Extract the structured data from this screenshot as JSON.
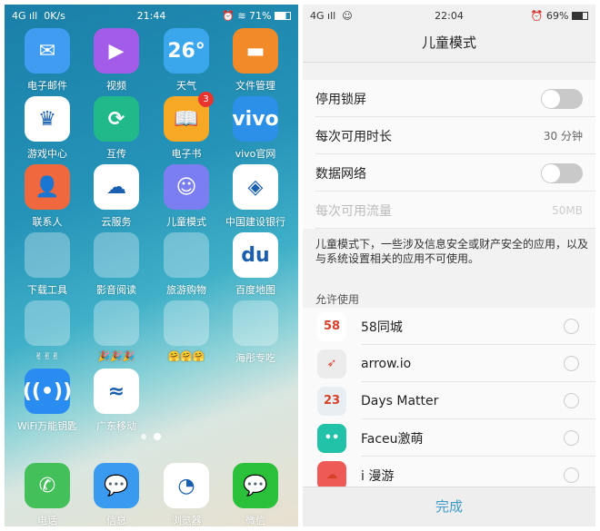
{
  "left_phone": {
    "status": {
      "network": "4G",
      "speed": "0K/s",
      "time": "21:44",
      "battery": "71%"
    },
    "apps": [
      {
        "label": "电子邮件",
        "icon": "mail-icon",
        "color": "#3f9cf0"
      },
      {
        "label": "视频",
        "icon": "play-icon",
        "color": "#a25ce8"
      },
      {
        "label": "天气",
        "icon": "weather-icon",
        "color": "#3aa6ec",
        "text": "26°"
      },
      {
        "label": "文件管理",
        "icon": "folder-icon",
        "color": "#f28a2a"
      },
      {
        "label": "游戏中心",
        "icon": "crown-icon",
        "color": "#ffffff"
      },
      {
        "label": "互传",
        "icon": "sync-icon",
        "color": "#21b98a"
      },
      {
        "label": "电子书",
        "icon": "book-icon",
        "color": "#f7a824",
        "badge": "3"
      },
      {
        "label": "vivo官网",
        "icon": "vivo-icon",
        "color": "#2c8fe8",
        "text": "vivo"
      },
      {
        "label": "联系人",
        "icon": "contact-icon",
        "color": "#f0683d"
      },
      {
        "label": "云服务",
        "icon": "cloud-icon",
        "color": "#ffffff"
      },
      {
        "label": "儿童模式",
        "icon": "baby-face-icon",
        "color": "#7b7ef0"
      },
      {
        "label": "中国建设银行",
        "icon": "ccb-icon",
        "color": "#ffffff"
      },
      {
        "label": "下载工具",
        "icon": "folder-group-icon",
        "folder": 5
      },
      {
        "label": "影音阅读",
        "icon": "folder-group-icon",
        "folder": 6
      },
      {
        "label": "旅游购物",
        "icon": "folder-group-icon",
        "folder": 9
      },
      {
        "label": "百度地图",
        "icon": "map-pin-icon",
        "color": "#ffffff",
        "text": "du"
      },
      {
        "label": "✌✌✌",
        "icon": "folder-group-icon",
        "folder": 7
      },
      {
        "label": "🎉🎉🎉",
        "icon": "folder-group-icon",
        "folder": 6
      },
      {
        "label": "🤗🤗🤗",
        "icon": "folder-group-icon",
        "folder": 9
      },
      {
        "label": "海彤专吃",
        "icon": "folder-group-icon",
        "folder": 2
      },
      {
        "label": "WiFi万能钥匙",
        "icon": "wifi-key-icon",
        "color": "#2a8cf0"
      },
      {
        "label": "广东移动",
        "icon": "china-mobile-icon",
        "color": "#ffffff"
      }
    ],
    "dock": [
      {
        "label": "电话",
        "icon": "phone-icon",
        "color": "#44c05a"
      },
      {
        "label": "信息",
        "icon": "message-icon",
        "color": "#3a9af0"
      },
      {
        "label": "浏览器",
        "icon": "compass-icon",
        "color": "#ffffff"
      },
      {
        "label": "微信",
        "icon": "wechat-icon",
        "color": "#2bc03a"
      }
    ]
  },
  "right_phone": {
    "status": {
      "network": "4G",
      "time": "22:04",
      "battery": "69%"
    },
    "title": "儿童模式",
    "settings": [
      {
        "label": "停用锁屏",
        "toggle": false
      },
      {
        "label": "每次可用时长",
        "value": "30 分钟"
      },
      {
        "label": "数据网络",
        "toggle": false
      },
      {
        "label": "每次可用流量",
        "value": "50MB",
        "disabled": true
      }
    ],
    "note": "儿童模式下，一些涉及信息安全或财产安全的应用，以及与系统设置相关的应用不可使用。",
    "section": "允许使用",
    "allowed_apps": [
      {
        "name": "58同城",
        "icon_text": "58",
        "color": "#ffffff",
        "selected": false
      },
      {
        "name": "arrow.io",
        "icon_text": "➶",
        "color": "#ececec",
        "selected": false
      },
      {
        "name": "Days Matter",
        "icon_text": "23",
        "color": "#e8eef2",
        "selected": false
      },
      {
        "name": "Faceu激萌",
        "icon_text": "••",
        "color": "#22c2a8",
        "selected": false
      },
      {
        "name": "i 漫游",
        "icon_text": "☁",
        "color": "#ee5a55",
        "selected": false
      }
    ],
    "done": "完成"
  }
}
